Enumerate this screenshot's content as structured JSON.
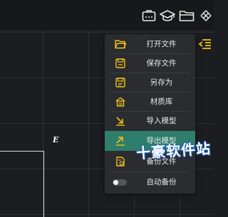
{
  "viewport": {
    "axis_label": "E"
  },
  "toolbar": {
    "icons": [
      "dashboard-box-icon",
      "graduation-cap-icon",
      "folder-icon",
      "expand-icon"
    ]
  },
  "menu": {
    "items": [
      {
        "label": "打开文件",
        "icon": "folder-open-icon"
      },
      {
        "label": "保存文件",
        "icon": "save-icon"
      },
      {
        "label": "另存为",
        "icon": "save-as-icon"
      },
      {
        "label": "材质库",
        "icon": "material-library-icon"
      },
      {
        "label": "导入模型",
        "icon": "import-icon"
      },
      {
        "label": "导出模型",
        "icon": "export-icon",
        "active": true
      },
      {
        "label": "备份文件",
        "icon": "backup-icon"
      },
      {
        "label": "自动备份",
        "icon": "toggle",
        "toggle_on": false
      }
    ]
  },
  "watermark": "十豪软件站",
  "colors": {
    "accent": "#f0c419",
    "active_bg": "#2f7d6b",
    "menu_bg": "#2b2c30",
    "canvas_bg": "#1c1d20"
  }
}
